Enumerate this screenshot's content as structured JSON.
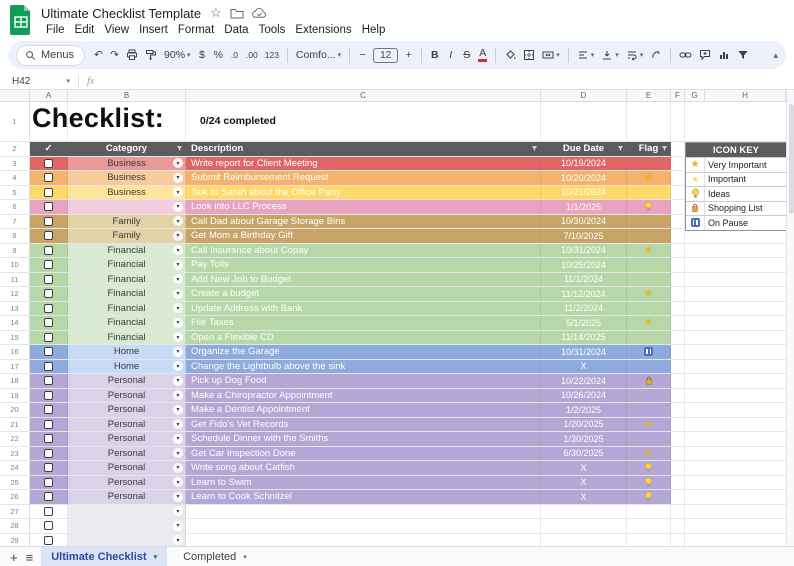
{
  "titlebar": {
    "title": "Ultimate Checklist Template",
    "menus": [
      "File",
      "Edit",
      "View",
      "Insert",
      "Format",
      "Data",
      "Tools",
      "Extensions",
      "Help"
    ]
  },
  "toolbar": {
    "menus_label": "Menus",
    "zoom": "90%",
    "currency": "$",
    "percent": "%",
    "decimal_decrease": ".0",
    "decimal_increase": ".00",
    "format_number": "123",
    "font": "Comfo...",
    "font_size": "12",
    "bold": "B",
    "italic": "I",
    "strikethrough": "S",
    "text_color": "A",
    "decrease_font": "−",
    "increase_font": "+"
  },
  "formula_bar": {
    "cell_ref": "H42",
    "fx": "fx"
  },
  "columns": [
    "A",
    "B",
    "C",
    "D",
    "E",
    "F",
    "G",
    "H"
  ],
  "colors": {
    "header_bg": "#5c5c5c",
    "business_red": "#e06666",
    "business_orange": "#f6b26b",
    "business_yellow": "#ffd966",
    "pink": "#e7a3c0",
    "family_tan": "#c8a567",
    "financial_green": "#b6d7a8",
    "home_blue": "#8faadc",
    "personal_purple": "#b4a7d6",
    "tab_active_bg": "#dce3f7",
    "tab_active_text": "#2b4d9e"
  },
  "sheet": {
    "title_row": {
      "num": "1",
      "title": "Checklist:",
      "completed": "0/24 completed"
    },
    "header_row": {
      "num": "2",
      "check": "✓",
      "category": "Category",
      "description": "Description",
      "due_date": "Due Date",
      "flag": "Flag"
    },
    "rows": [
      {
        "num": "3",
        "category": "Business",
        "description": "Write report for Client Meeting",
        "due": "10/19/2024",
        "flag": "",
        "row_color": "#e06666",
        "cat_color": "#ea9999"
      },
      {
        "num": "4",
        "category": "Business",
        "description": "Submit Reimbursement Request",
        "due": "10/20/2024",
        "flag": "star",
        "row_color": "#f6b26b",
        "cat_color": "#f9cb9c"
      },
      {
        "num": "5",
        "category": "Business",
        "description": "Talk to Sarah about the Office Party",
        "due": "10/21/2024",
        "flag": "",
        "row_color": "#ffd966",
        "cat_color": "#ffe599"
      },
      {
        "num": "6",
        "category": "",
        "description": "Look into LLC Process",
        "due": "1/1/2025",
        "flag": "bulb",
        "row_color": "#e7a3c0",
        "cat_color": "#f2cddd"
      },
      {
        "num": "7",
        "category": "Family",
        "description": "Call Dad about Garage Storage Bins",
        "due": "10/30/2024",
        "flag": "",
        "row_color": "#c8a567",
        "cat_color": "#e3d2a6"
      },
      {
        "num": "8",
        "category": "Family",
        "description": "Get Mom a Birthday Gift",
        "due": "7/10/2025",
        "flag": "",
        "row_color": "#c8a567",
        "cat_color": "#e3d2a6"
      },
      {
        "num": "9",
        "category": "Financial",
        "description": "Call Insurance about Copay",
        "due": "10/31/2024",
        "flag": "star",
        "row_color": "#b6d7a8",
        "cat_color": "#d9ead3"
      },
      {
        "num": "10",
        "category": "Financial",
        "description": "Pay Tolls",
        "due": "10/25/2024",
        "flag": "",
        "row_color": "#b6d7a8",
        "cat_color": "#d9ead3"
      },
      {
        "num": "11",
        "category": "Financial",
        "description": "Add New Job to Budget",
        "due": "11/1/2024",
        "flag": "",
        "row_color": "#b6d7a8",
        "cat_color": "#d9ead3"
      },
      {
        "num": "12",
        "category": "Financial",
        "description": "Create a budget",
        "due": "11/12/2024",
        "flag": "star",
        "row_color": "#b6d7a8",
        "cat_color": "#d9ead3"
      },
      {
        "num": "13",
        "category": "Financial",
        "description": "Update Address with Bank",
        "due": "11/2/2024",
        "flag": "",
        "row_color": "#b6d7a8",
        "cat_color": "#d9ead3"
      },
      {
        "num": "14",
        "category": "Financial",
        "description": "File Taxes",
        "due": "5/1/2025",
        "flag": "star",
        "row_color": "#b6d7a8",
        "cat_color": "#d9ead3"
      },
      {
        "num": "15",
        "category": "Financial",
        "description": "Open a Flexible CD",
        "due": "11/14/2025",
        "flag": "",
        "row_color": "#b6d7a8",
        "cat_color": "#d9ead3"
      },
      {
        "num": "16",
        "category": "Home",
        "description": "Organize the Garage",
        "due": "10/31/2024",
        "flag": "pause",
        "row_color": "#8faadc",
        "cat_color": "#c9daf8"
      },
      {
        "num": "17",
        "category": "Home",
        "description": "Change the Lightbulb above the sink",
        "due": "X",
        "flag": "",
        "row_color": "#8faadc",
        "cat_color": "#c9daf8"
      },
      {
        "num": "18",
        "category": "Personal",
        "description": "Pick up Dog Food",
        "due": "10/22/2024",
        "flag": "shopping",
        "row_color": "#b4a7d6",
        "cat_color": "#d9d2e9"
      },
      {
        "num": "19",
        "category": "Personal",
        "description": "Make a Chiropractor Appointment",
        "due": "10/26/2024",
        "flag": "",
        "row_color": "#b4a7d6",
        "cat_color": "#d9d2e9"
      },
      {
        "num": "20",
        "category": "Personal",
        "description": "Make a Dentist Appointment",
        "due": "1/2/2025",
        "flag": "",
        "row_color": "#b4a7d6",
        "cat_color": "#d9d2e9"
      },
      {
        "num": "21",
        "category": "Personal",
        "description": "Get Fido's Vet Records",
        "due": "1/20/2025",
        "flag": "star",
        "row_color": "#b4a7d6",
        "cat_color": "#d9d2e9"
      },
      {
        "num": "22",
        "category": "Personal",
        "description": "Schedule Dinner with the Smiths",
        "due": "1/30/2025",
        "flag": "",
        "row_color": "#b4a7d6",
        "cat_color": "#d9d2e9"
      },
      {
        "num": "23",
        "category": "Personal",
        "description": "Get Car Inspection Done",
        "due": "6/30/2025",
        "flag": "star",
        "row_color": "#b4a7d6",
        "cat_color": "#d9d2e9"
      },
      {
        "num": "24",
        "category": "Personal",
        "description": "Write song about Catfish",
        "due": "X",
        "flag": "bulb",
        "row_color": "#b4a7d6",
        "cat_color": "#d9d2e9"
      },
      {
        "num": "25",
        "category": "Personal",
        "description": "Learn to Swim",
        "due": "X",
        "flag": "bulb",
        "row_color": "#b4a7d6",
        "cat_color": "#d9d2e9"
      },
      {
        "num": "26",
        "category": "Personal",
        "description": "Learn to Cook Schnitzel",
        "due": "X",
        "flag": "bulb",
        "row_color": "#b4a7d6",
        "cat_color": "#d9d2e9"
      },
      {
        "num": "27",
        "empty": true
      },
      {
        "num": "28",
        "empty": true
      },
      {
        "num": "29",
        "empty": true
      }
    ]
  },
  "icon_key": {
    "title": "ICON KEY",
    "items": [
      {
        "icon": "star-gold",
        "label": "Very Important"
      },
      {
        "icon": "star-yellow",
        "label": "Important"
      },
      {
        "icon": "lightbulb",
        "label": "Ideas"
      },
      {
        "icon": "shopping-bag",
        "label": "Shopping List"
      },
      {
        "icon": "pause",
        "label": "On Pause"
      }
    ]
  },
  "tabbar": {
    "tabs": [
      {
        "label": "Ultimate Checklist",
        "active": true
      },
      {
        "label": "Completed",
        "active": false
      }
    ]
  }
}
